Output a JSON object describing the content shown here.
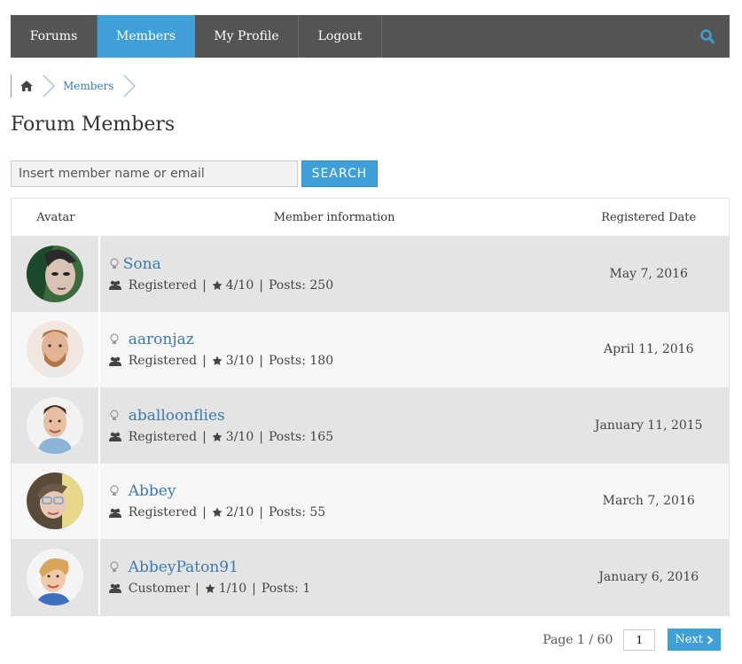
{
  "nav": {
    "items": [
      {
        "label": "Forums",
        "active": false
      },
      {
        "label": "Members",
        "active": true
      },
      {
        "label": "My Profile",
        "active": false
      },
      {
        "label": "Logout",
        "active": false
      }
    ],
    "search_icon": "search-icon"
  },
  "breadcrumb": {
    "home_icon": "home-icon",
    "current": "Members"
  },
  "page": {
    "title": "Forum Members"
  },
  "search": {
    "placeholder": "Insert member name or email",
    "button_label": "SEARCH"
  },
  "table": {
    "headers": {
      "avatar": "Avatar",
      "info": "Member information",
      "date": "Registered Date"
    },
    "rows": [
      {
        "name": "Sona",
        "role": "Registered",
        "rating": "4/10",
        "posts": "Posts: 250",
        "date": "May 7, 2016"
      },
      {
        "name": "aaronjaz",
        "role": "Registered",
        "rating": "3/10",
        "posts": "Posts: 180",
        "date": "April 11, 2016"
      },
      {
        "name": "aballoonflies",
        "role": "Registered",
        "rating": "3/10",
        "posts": "Posts: 165",
        "date": "January 11, 2015"
      },
      {
        "name": "Abbey",
        "role": "Registered",
        "rating": "2/10",
        "posts": "Posts: 55",
        "date": "March 7, 2016"
      },
      {
        "name": "AbbeyPaton91",
        "role": "Customer",
        "rating": "1/10",
        "posts": "Posts: 1",
        "date": "January 6, 2016"
      }
    ]
  },
  "pagination": {
    "text": "Page 1 / 60",
    "input_value": "1",
    "next_label": "Next"
  },
  "colors": {
    "accent": "#3fa0d9",
    "nav_bg": "#545454",
    "link": "#3b7ab0"
  }
}
